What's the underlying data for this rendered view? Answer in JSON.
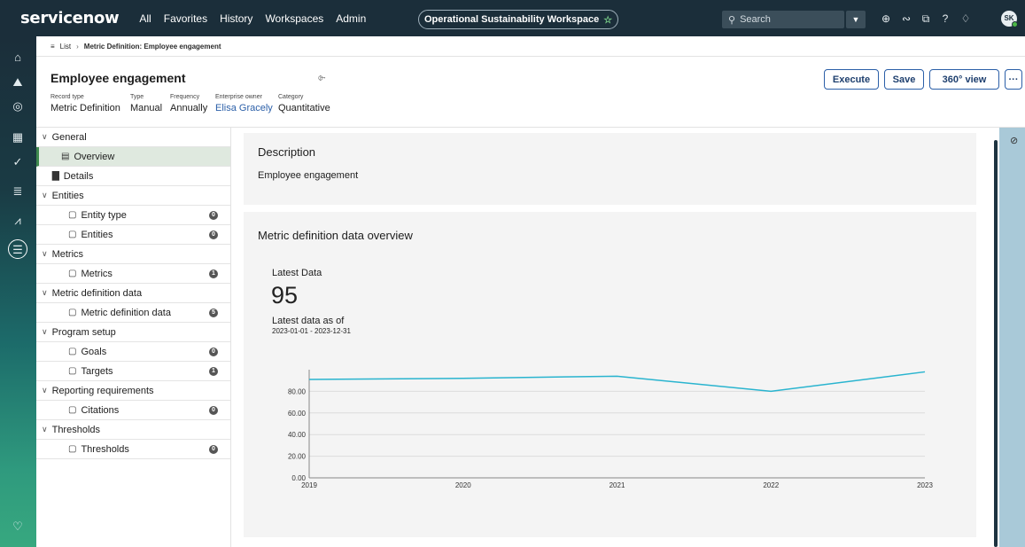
{
  "topbar": {
    "logo": "servicenow",
    "nav": [
      "All",
      "Favorites",
      "History",
      "Workspaces",
      "Admin"
    ],
    "workspace": "Operational Sustainability Workspace",
    "search_placeholder": "Search",
    "avatar_initials": "SK"
  },
  "breadcrumb": {
    "list_label": "List",
    "current": "Metric Definition: Employee engagement"
  },
  "record": {
    "title": "Employee engagement",
    "fields": [
      {
        "label": "Record type",
        "value": "Metric Definition"
      },
      {
        "label": "Type",
        "value": "Manual"
      },
      {
        "label": "Frequency",
        "value": "Annually"
      },
      {
        "label": "Enterprise owner",
        "value": "Elisa Gracely"
      },
      {
        "label": "Category",
        "value": "Quantitative"
      }
    ],
    "buttons": {
      "execute": "Execute",
      "save": "Save",
      "view360": "360° view",
      "more": "···"
    }
  },
  "tree": [
    {
      "label": "General",
      "type": "group"
    },
    {
      "label": "Overview",
      "type": "item",
      "selected": true
    },
    {
      "label": "Details",
      "type": "item"
    },
    {
      "label": "Entities",
      "type": "group"
    },
    {
      "label": "Entity type",
      "type": "item",
      "count": "0"
    },
    {
      "label": "Entities",
      "type": "item",
      "count": "0"
    },
    {
      "label": "Metrics",
      "type": "group"
    },
    {
      "label": "Metrics",
      "type": "item",
      "count": "1"
    },
    {
      "label": "Metric definition data",
      "type": "group"
    },
    {
      "label": "Metric definition data",
      "type": "item",
      "count": "5"
    },
    {
      "label": "Program setup",
      "type": "group"
    },
    {
      "label": "Goals",
      "type": "item",
      "count": "0"
    },
    {
      "label": "Targets",
      "type": "item",
      "count": "1"
    },
    {
      "label": "Reporting requirements",
      "type": "group"
    },
    {
      "label": "Citations",
      "type": "item",
      "count": "0"
    },
    {
      "label": "Thresholds",
      "type": "group"
    },
    {
      "label": "Thresholds",
      "type": "item",
      "count": "0"
    }
  ],
  "description": {
    "title": "Description",
    "text": "Employee engagement"
  },
  "overview": {
    "title": "Metric definition data overview",
    "latest_label": "Latest Data",
    "latest_value": "95",
    "as_of_label": "Latest data as of",
    "as_of_range": "2023-01-01 - 2023-12-31"
  },
  "chart_data": {
    "type": "line",
    "x": [
      "2019",
      "2020",
      "2021",
      "2022",
      "2023"
    ],
    "series": [
      {
        "values": [
          91,
          92,
          94,
          80,
          98
        ]
      }
    ],
    "yticks": [
      "0.00",
      "20.00",
      "40.00",
      "60.00",
      "80.00"
    ],
    "ylim": [
      0,
      100
    ],
    "color": "#29b4cf",
    "grid": true
  }
}
